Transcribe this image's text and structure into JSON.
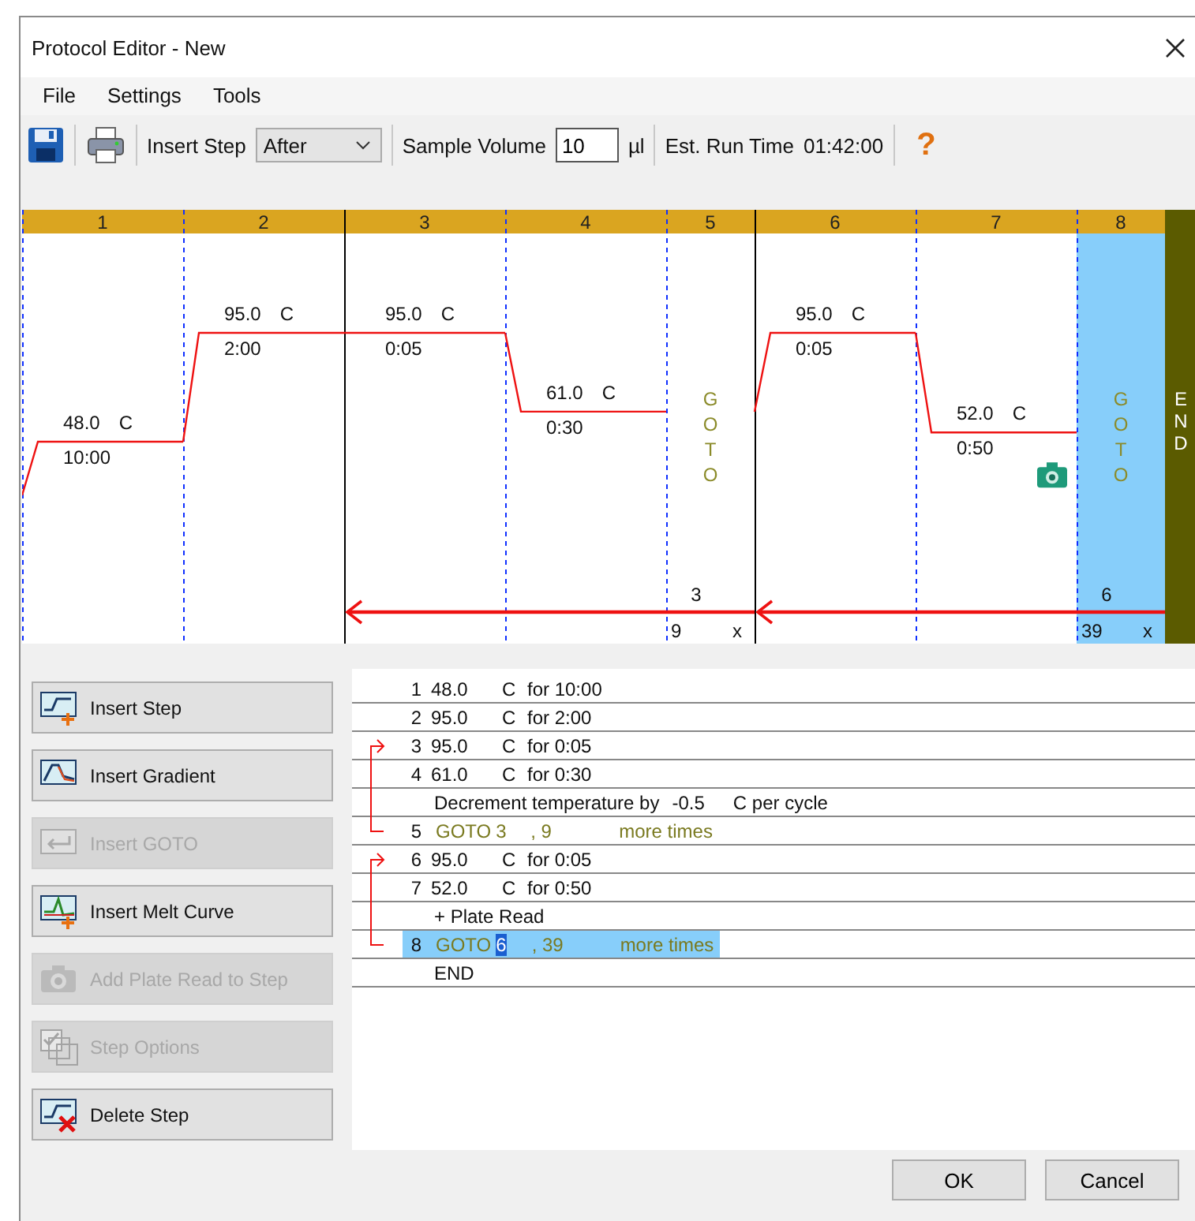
{
  "window": {
    "title": "Protocol Editor - New"
  },
  "menu": [
    "File",
    "Settings",
    "Tools"
  ],
  "toolbar": {
    "insert_step_label": "Insert Step",
    "insert_position": "After",
    "sample_volume_label": "Sample Volume",
    "sample_volume": "10",
    "sample_volume_unit": "µl",
    "run_time_label": "Est. Run Time",
    "run_time": "01:42:00",
    "help": "?"
  },
  "graph": {
    "end_label": "END",
    "steps": [
      {
        "number": "1",
        "kind": "temp",
        "temp": "48.0",
        "unit": "C",
        "time": "10:00",
        "plate_read": false,
        "selected": false
      },
      {
        "number": "2",
        "kind": "temp",
        "temp": "95.0",
        "unit": "C",
        "time": "2:00",
        "plate_read": false,
        "selected": false
      },
      {
        "number": "3",
        "kind": "temp",
        "temp": "95.0",
        "unit": "C",
        "time": "0:05",
        "plate_read": false,
        "selected": false
      },
      {
        "number": "4",
        "kind": "temp",
        "temp": "61.0",
        "unit": "C",
        "time": "0:30",
        "plate_read": false,
        "selected": false
      },
      {
        "number": "5",
        "kind": "goto",
        "label": "GOTO",
        "target": "3",
        "count": "9",
        "times_mark": "x",
        "selected": false
      },
      {
        "number": "6",
        "kind": "temp",
        "temp": "95.0",
        "unit": "C",
        "time": "0:05",
        "plate_read": false,
        "selected": false
      },
      {
        "number": "7",
        "kind": "temp",
        "temp": "52.0",
        "unit": "C",
        "time": "0:50",
        "plate_read": true,
        "selected": false
      },
      {
        "number": "8",
        "kind": "goto",
        "label": "GOTO",
        "target": "6",
        "count": "39",
        "times_mark": "x",
        "selected": true
      }
    ]
  },
  "actions": [
    {
      "label": "Insert Step",
      "kind": "insert-step",
      "disabled": false
    },
    {
      "label": "Insert Gradient",
      "kind": "gradient",
      "disabled": false
    },
    {
      "label": "Insert GOTO",
      "kind": "goto",
      "disabled": true
    },
    {
      "label": "Insert Melt Curve",
      "kind": "melt",
      "disabled": false
    },
    {
      "label": "Add Plate Read to Step",
      "kind": "camera",
      "disabled": true
    },
    {
      "label": "Step Options",
      "kind": "options",
      "disabled": true
    },
    {
      "label": "Delete Step",
      "kind": "delete",
      "disabled": false
    }
  ],
  "listing": [
    {
      "kind": "step",
      "number": "1",
      "temp": "48.0",
      "unit": "C",
      "time_text": "for 10:00"
    },
    {
      "kind": "step",
      "number": "2",
      "temp": "95.0",
      "unit": "C",
      "time_text": "for 2:00"
    },
    {
      "kind": "step",
      "number": "3",
      "temp": "95.0",
      "unit": "C",
      "time_text": "for 0:05"
    },
    {
      "kind": "step",
      "number": "4",
      "temp": "61.0",
      "unit": "C",
      "time_text": "for 0:30"
    },
    {
      "kind": "note",
      "text": "Decrement temperature by",
      "value": "-0.5",
      "unit": "C per cycle"
    },
    {
      "kind": "goto",
      "number": "5",
      "label": "GOTO",
      "target": "3",
      "count": ", 9",
      "suffix": "more times",
      "selected": false
    },
    {
      "kind": "step",
      "number": "6",
      "temp": "95.0",
      "unit": "C",
      "time_text": "for 0:05"
    },
    {
      "kind": "step",
      "number": "7",
      "temp": "52.0",
      "unit": "C",
      "time_text": "for 0:50"
    },
    {
      "kind": "note",
      "text": "+ Plate Read"
    },
    {
      "kind": "goto",
      "number": "8",
      "label": "GOTO",
      "target": "6",
      "count": ", 39",
      "suffix": "more times",
      "selected": true
    },
    {
      "kind": "end",
      "text": "END"
    }
  ],
  "footer": [
    "OK",
    "Cancel"
  ]
}
